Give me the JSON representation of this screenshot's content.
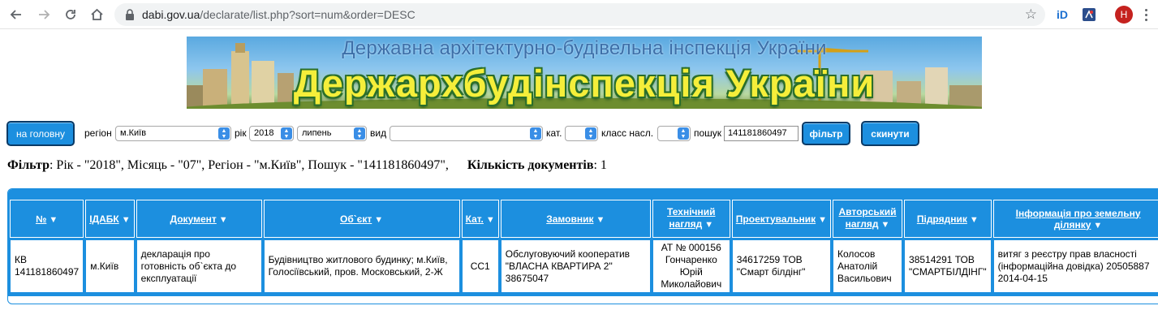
{
  "browser": {
    "url_host": "dabi.gov.ua",
    "url_path": "/declarate/list.php?sort=num&order=DESC",
    "avatar_letter": "H",
    "ext1_label": "iD"
  },
  "banner": {
    "line1": "Державна архітектурно-будівельна інспекція України",
    "line2": "Держархбудінспекція України"
  },
  "filters": {
    "home_button": "на головну",
    "region_label": "регіон",
    "region_value": "м.Київ",
    "year_label": "рік",
    "year_value": "2018",
    "month_value": "липень",
    "type_label": "вид",
    "type_value": "",
    "category_label": "кат.",
    "category_value": "",
    "class_label": "класс насл.",
    "class_value": "",
    "search_label": "пошук",
    "search_value": "141181860497",
    "filter_button": "фільтр",
    "reset_button": "скинути"
  },
  "summary": {
    "filter_label": "Фільтр",
    "filter_text": ": Рік - \"2018\", Місяць - \"07\", Регіон - \"м.Київ\", Пошук - \"141181860497\",",
    "count_label": "Кількість документів",
    "count_value": ": 1"
  },
  "table": {
    "headers": [
      "№",
      "ІДАБК",
      "Документ",
      "Об`єкт",
      "Кат.",
      "Замовник",
      "Технічний нагляд",
      "Проектувальник",
      "Авторський нагляд",
      "Підрядник",
      "Інформація про земельну ділянку"
    ],
    "row": {
      "num": "КВ 141181860497",
      "idabk": "м.Київ",
      "document": "декларація про готовність об`єкта до експлуатації",
      "object": "Будівництво житлового будинку; м.Київ, Голосіївський, пров. Московський, 2-Ж",
      "category": "СС1",
      "customer": "Обслуговуючий кооператив \"ВЛАСНА КВАРТИРА 2\" 38675047",
      "tech_supervision": "АТ № 000156 Гончаренко Юрій Миколайович",
      "designer": "34617259 ТОВ \"Смарт білдінг\"",
      "author_supervision": "Колосов Анатолій Васильович",
      "contractor": "38514291 ТОВ \"СМАРТБІЛДІНГ\"",
      "land_info": "витяг з реєстру прав власності (інформаційна довідка) 20505887 2014-04-15"
    }
  },
  "colors": {
    "accent": "#1c8fdf",
    "button_border": "#0a3a66",
    "banner_title": "#f5ee3a"
  }
}
